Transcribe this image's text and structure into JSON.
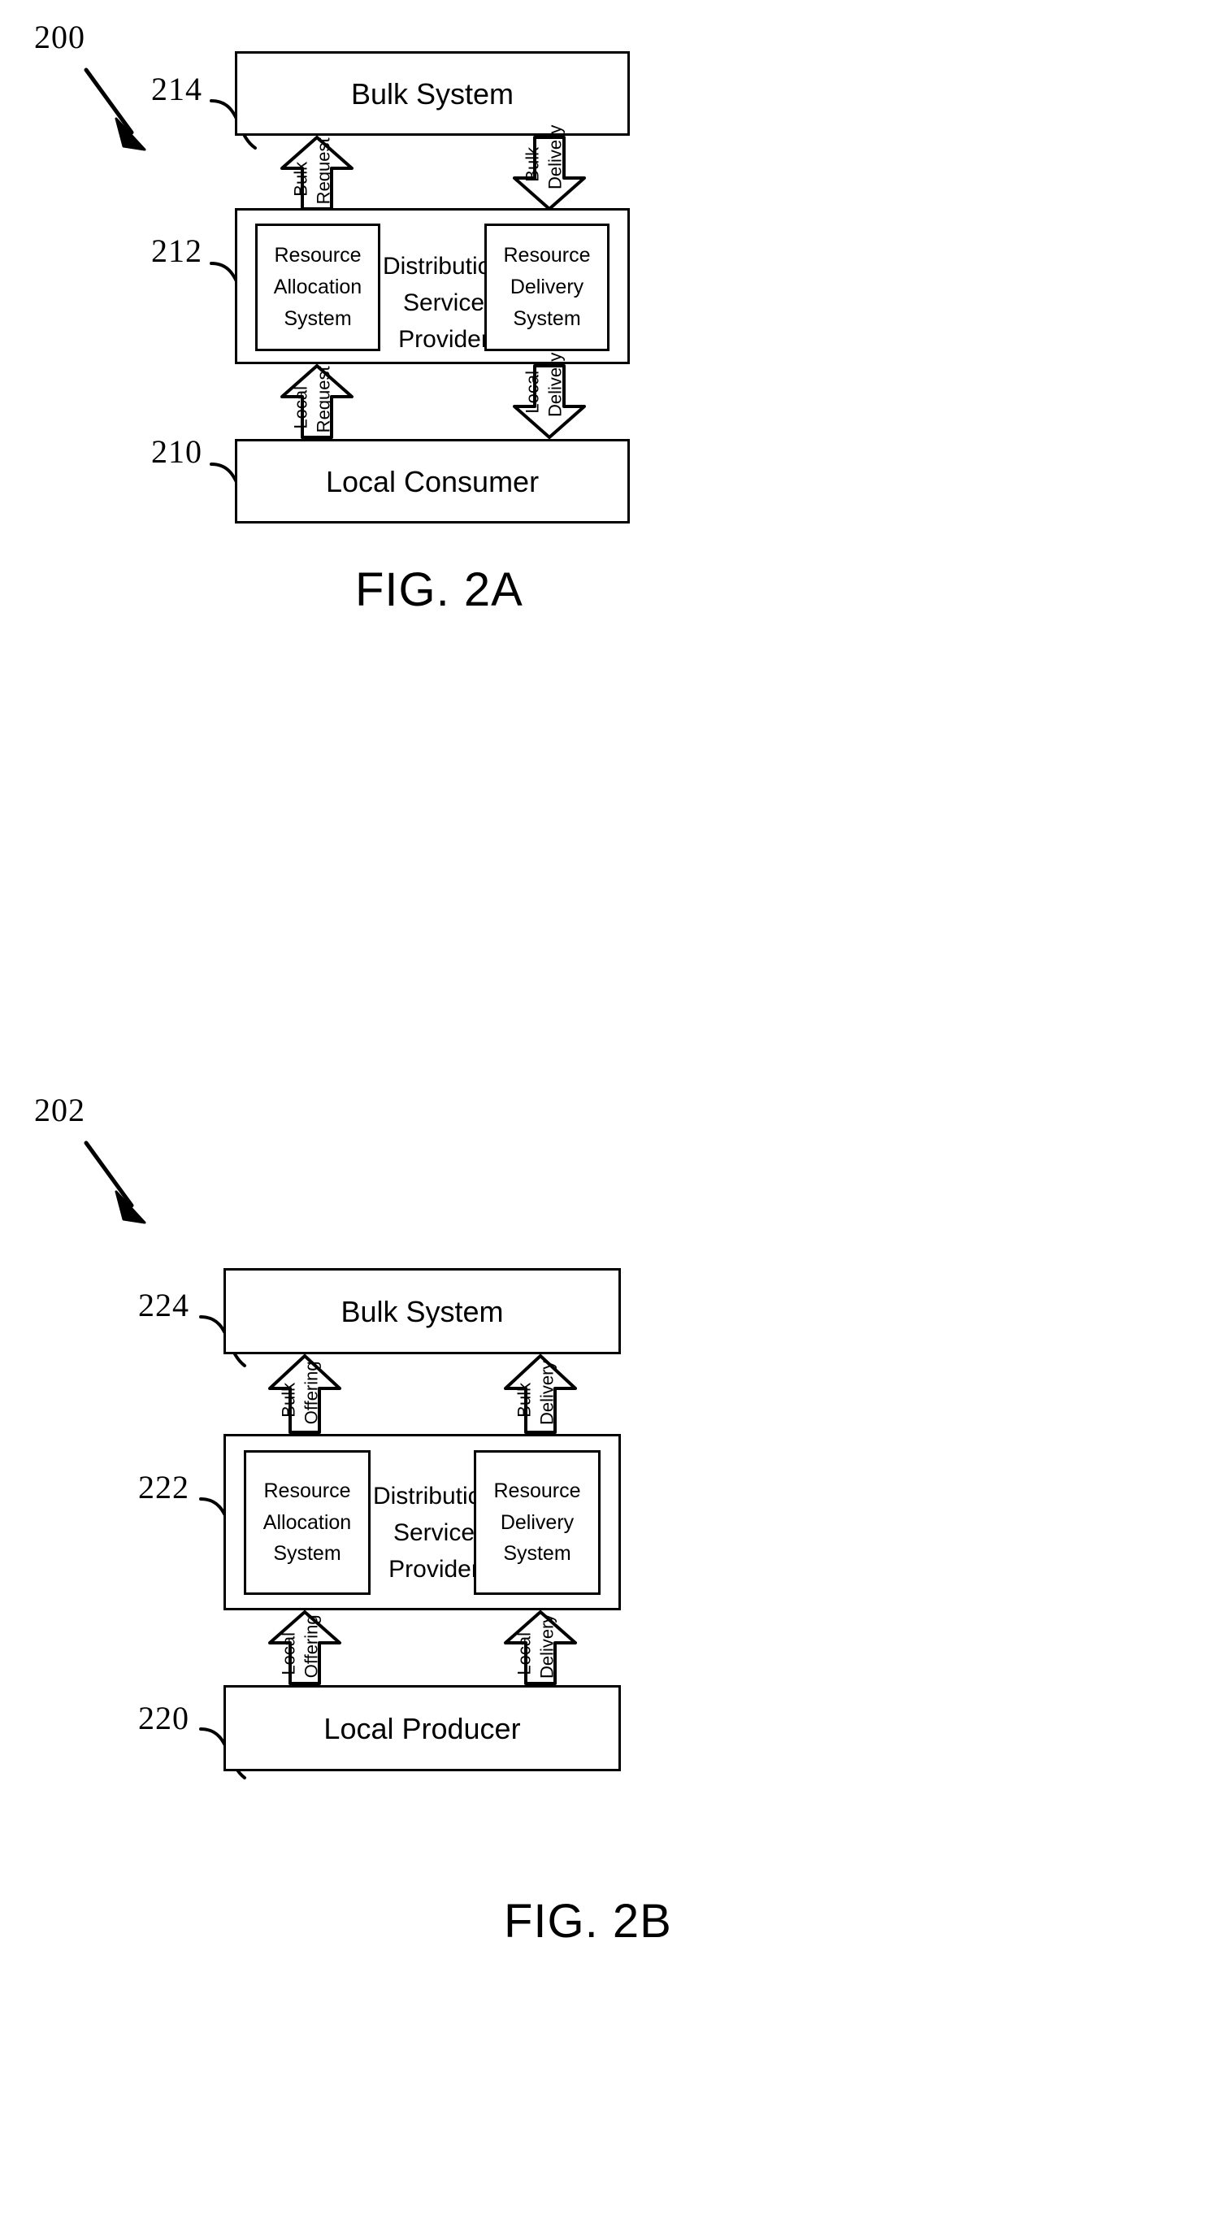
{
  "document": {
    "type": "patent-drawing-sheet",
    "figures": [
      {
        "id": "fig2a",
        "caption": "FIG. 2A",
        "system_ref": "200",
        "blocks": [
          {
            "ref": "214",
            "label": "Bulk System"
          },
          {
            "ref": "212",
            "label": "Distribution\nService\nProvider",
            "label_lines": [
              "Distribution",
              "Service",
              "Provider"
            ],
            "children": [
              {
                "label_lines": [
                  "Resource",
                  "Allocation",
                  "System"
                ]
              },
              {
                "label_lines": [
                  "Resource",
                  "Delivery",
                  "System"
                ]
              }
            ]
          },
          {
            "ref": "210",
            "label": "Local Consumer"
          }
        ],
        "flows": [
          {
            "label_lines": [
              "Bulk",
              "Request"
            ],
            "direction": "up",
            "from": "212",
            "to": "214"
          },
          {
            "label_lines": [
              "Bulk",
              "Delivery"
            ],
            "direction": "down",
            "from": "214",
            "to": "212"
          },
          {
            "label_lines": [
              "Local",
              "Request"
            ],
            "direction": "up",
            "from": "210",
            "to": "212"
          },
          {
            "label_lines": [
              "Local",
              "Delivery"
            ],
            "direction": "down",
            "from": "212",
            "to": "210"
          }
        ]
      },
      {
        "id": "fig2b",
        "caption": "FIG. 2B",
        "system_ref": "202",
        "blocks": [
          {
            "ref": "224",
            "label": "Bulk System"
          },
          {
            "ref": "222",
            "label": "Distribution\nService\nProvider",
            "label_lines": [
              "Distribution",
              "Service",
              "Provider"
            ],
            "children": [
              {
                "label_lines": [
                  "Resource",
                  "Allocation",
                  "System"
                ]
              },
              {
                "label_lines": [
                  "Resource",
                  "Delivery",
                  "System"
                ]
              }
            ]
          },
          {
            "ref": "220",
            "label": "Local Producer"
          }
        ],
        "flows": [
          {
            "label_lines": [
              "Bulk",
              "Offering"
            ],
            "direction": "up",
            "from": "222",
            "to": "224"
          },
          {
            "label_lines": [
              "Bulk",
              "Delivery"
            ],
            "direction": "up",
            "from": "222",
            "to": "224"
          },
          {
            "label_lines": [
              "Local",
              "Offering"
            ],
            "direction": "up",
            "from": "220",
            "to": "222"
          },
          {
            "label_lines": [
              "Local",
              "Delivery"
            ],
            "direction": "up",
            "from": "220",
            "to": "222"
          }
        ]
      }
    ]
  },
  "fig2a": {
    "system_ref": "200",
    "caption": "FIG. 2A",
    "bulk": {
      "ref": "214",
      "label": "Bulk System"
    },
    "provider": {
      "ref": "212",
      "line1": "Distribution",
      "line2": "Service",
      "line3": "Provider",
      "alloc": {
        "line1": "Resource",
        "line2": "Allocation",
        "line3": "System"
      },
      "delivery": {
        "line1": "Resource",
        "line2": "Delivery",
        "line3": "System"
      }
    },
    "consumer": {
      "ref": "210",
      "label": "Local Consumer"
    },
    "arrows": {
      "bulk_request": {
        "line1": "Bulk",
        "line2": "Request"
      },
      "bulk_delivery": {
        "line1": "Bulk",
        "line2": "Delivery"
      },
      "local_request": {
        "line1": "Local",
        "line2": "Request"
      },
      "local_delivery": {
        "line1": "Local",
        "line2": "Delivery"
      }
    }
  },
  "fig2b": {
    "system_ref": "202",
    "caption": "FIG. 2B",
    "bulk": {
      "ref": "224",
      "label": "Bulk System"
    },
    "provider": {
      "ref": "222",
      "line1": "Distribution",
      "line2": "Service",
      "line3": "Provider",
      "alloc": {
        "line1": "Resource",
        "line2": "Allocation",
        "line3": "System"
      },
      "delivery": {
        "line1": "Resource",
        "line2": "Delivery",
        "line3": "System"
      }
    },
    "producer": {
      "ref": "220",
      "label": "Local Producer"
    },
    "arrows": {
      "bulk_offering": {
        "line1": "Bulk",
        "line2": "Offering"
      },
      "bulk_delivery": {
        "line1": "Bulk",
        "line2": "Delivery"
      },
      "local_offering": {
        "line1": "Local",
        "line2": "Offering"
      },
      "local_delivery": {
        "line1": "Local",
        "line2": "Delivery"
      }
    }
  },
  "colors": {
    "ink": "#000000",
    "paper": "#ffffff"
  }
}
